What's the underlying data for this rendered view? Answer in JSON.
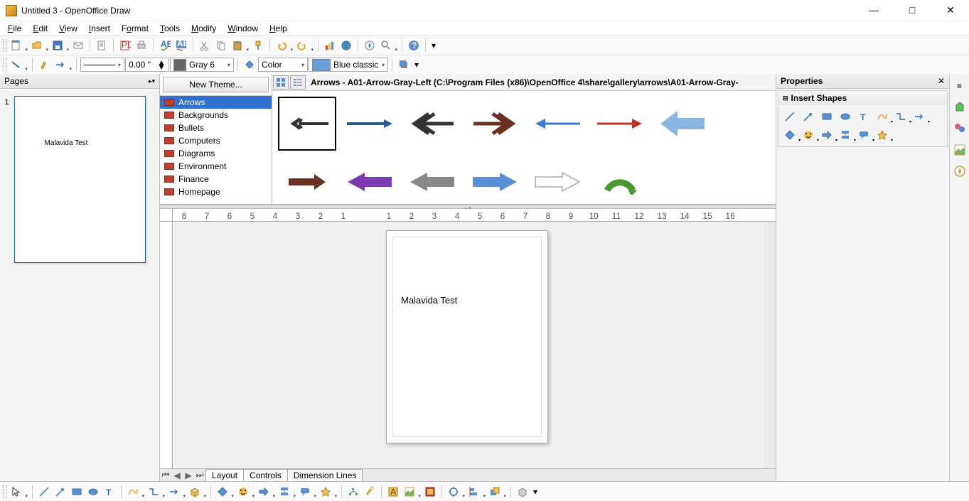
{
  "window": {
    "title": "Untitled 3 - OpenOffice Draw"
  },
  "menu": [
    "File",
    "Edit",
    "View",
    "Insert",
    "Format",
    "Tools",
    "Modify",
    "Window",
    "Help"
  ],
  "toolbar2": {
    "line_width": "0.00 \"",
    "color_name": "Gray 6",
    "color_hex": "#666666",
    "fill_mode": "Color",
    "fill_name": "Blue classic",
    "fill_swatch": "#6a9ed8"
  },
  "pages": {
    "title": "Pages",
    "items": [
      {
        "num": "1",
        "text": "Malavida Test"
      }
    ]
  },
  "gallery": {
    "new_theme": "New Theme...",
    "themes": [
      "Arrows",
      "Backgrounds",
      "Bullets",
      "Computers",
      "Diagrams",
      "Environment",
      "Finance",
      "Homepage"
    ],
    "selected": 0,
    "path": "Arrows - A01-Arrow-Gray-Left (C:\\Program Files (x86)\\OpenOffice 4\\share\\gallery\\arrows\\A01-Arrow-Gray-"
  },
  "canvas": {
    "text": "Malavida Test"
  },
  "tabs": {
    "items": [
      "Layout",
      "Controls",
      "Dimension Lines"
    ],
    "active": 0
  },
  "properties": {
    "title": "Properties",
    "section": "Insert Shapes"
  },
  "ruler_ticks": [
    "8",
    "7",
    "6",
    "5",
    "4",
    "3",
    "2",
    "1",
    "",
    "1",
    "2",
    "3",
    "4",
    "5",
    "6",
    "7",
    "8",
    "9",
    "10",
    "11",
    "12",
    "13",
    "14",
    "15",
    "16"
  ]
}
